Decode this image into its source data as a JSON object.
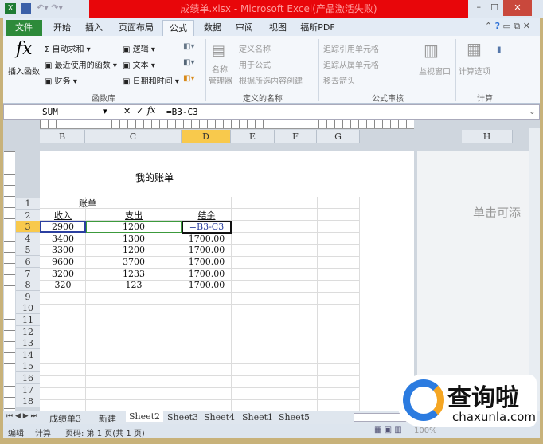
{
  "window": {
    "title": "成绩单.xlsx - Microsoft Excel(产品激活失败)",
    "controls": [
      "minimize",
      "maximize",
      "close"
    ]
  },
  "ribbon_tabs": [
    "文件",
    "开始",
    "插入",
    "页面布局",
    "公式",
    "数据",
    "审阅",
    "视图",
    "福昕PDF"
  ],
  "active_tab": "公式",
  "ribbon": {
    "insert_function": "插入函数",
    "autosum": "自动求和",
    "recent": "最近使用的函数",
    "financial": "财务",
    "logical": "逻辑",
    "text": "文本",
    "datetime": "日期和时间",
    "group_library": "函数库",
    "name_manager_1": "名称",
    "name_manager_2": "管理器",
    "define_name": "定义名称",
    "use_in_formula": "用于公式",
    "create_from_selection": "根据所选内容创建",
    "group_names": "定义的名称",
    "trace_precedents": "追踪引用单元格",
    "trace_dependents": "追踪从属单元格",
    "remove_arrows": "移去箭头",
    "watch_window": "监视窗口",
    "group_audit": "公式审核",
    "calc_options": "计算选项",
    "group_calc": "计算"
  },
  "formula_bar": {
    "name_box": "SUM",
    "formula": "=B3-C3"
  },
  "columns": [
    "B",
    "C",
    "D",
    "E",
    "F",
    "G",
    "H"
  ],
  "active_column": "D",
  "header_text": "我的账单",
  "click_to_add": "单击可添",
  "rows": [
    "1",
    "2",
    "3",
    "4",
    "5",
    "6",
    "7",
    "8",
    "9",
    "10",
    "11",
    "12",
    "13",
    "14",
    "15",
    "16",
    "17",
    "18"
  ],
  "active_row": "3",
  "table": {
    "title": "账单",
    "headers": [
      "收入",
      "支出",
      "结余"
    ],
    "data": [
      [
        "2900",
        "1200",
        "=B3-C3"
      ],
      [
        "3400",
        "1300",
        "1700.00"
      ],
      [
        "3300",
        "1200",
        "1700.00"
      ],
      [
        "9600",
        "3700",
        "1700.00"
      ],
      [
        "3200",
        "1233",
        "1700.00"
      ],
      [
        "320",
        "123",
        "1700.00"
      ]
    ]
  },
  "sheet_tabs": [
    "成绩单3",
    "新建",
    "Sheet2",
    "Sheet3",
    "Sheet4",
    "Sheet1",
    "Sheet5"
  ],
  "active_sheet": "Sheet2",
  "status": {
    "mode": "编辑",
    "calc": "计算",
    "page": "页码: 第 1 页(共 1 页)",
    "zoom": "100%"
  },
  "watermark": {
    "brand": "查询啦",
    "url": "chaxunla.com"
  }
}
